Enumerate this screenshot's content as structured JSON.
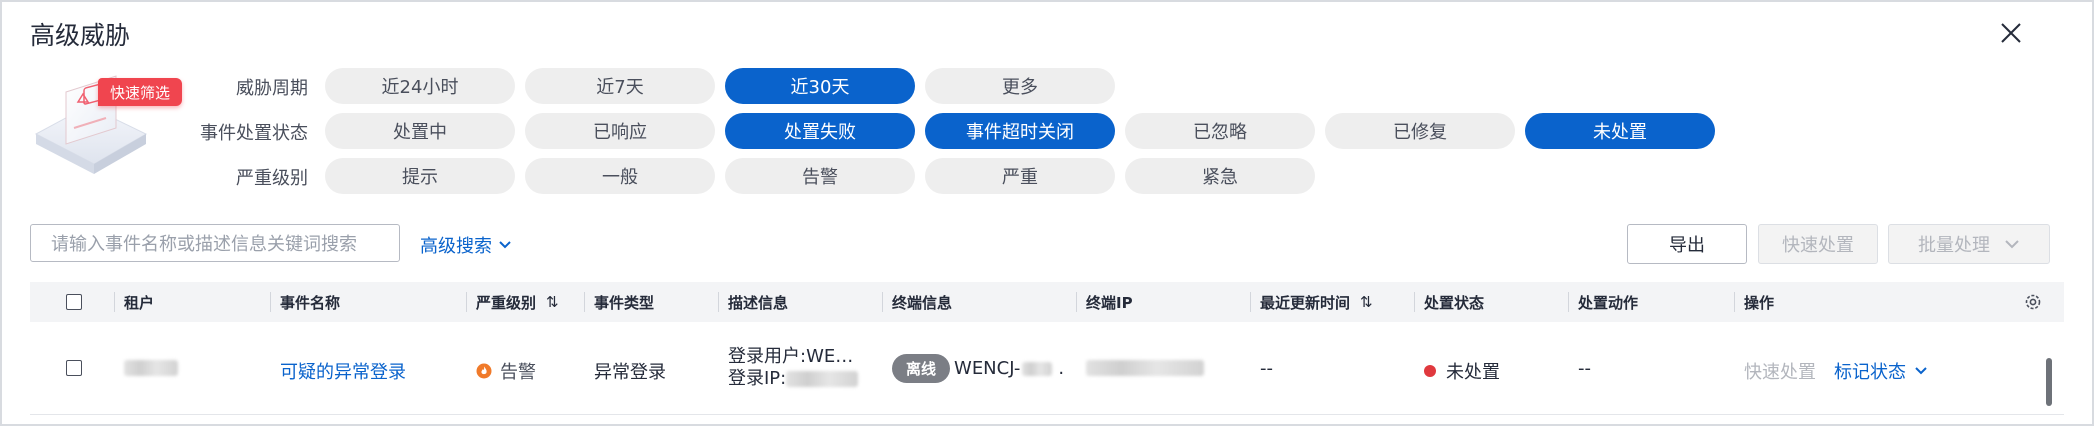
{
  "dialog": {
    "title": "高级威胁"
  },
  "quick_filter": {
    "badge": "快速筛选"
  },
  "filters": {
    "period": {
      "label": "威胁周期",
      "options": [
        "近24小时",
        "近7天",
        "近30天",
        "更多"
      ],
      "selected": [
        "近30天"
      ]
    },
    "status": {
      "label": "事件处置状态",
      "options": [
        "处置中",
        "已响应",
        "处置失败",
        "事件超时关闭",
        "已忽略",
        "已修复",
        "未处置"
      ],
      "selected": [
        "处置失败",
        "事件超时关闭",
        "未处置"
      ]
    },
    "severity": {
      "label": "严重级别",
      "options": [
        "提示",
        "一般",
        "告警",
        "严重",
        "紧急"
      ],
      "selected": []
    }
  },
  "toolbar": {
    "search_placeholder": "请输入事件名称或描述信息关键词搜索",
    "advanced_search": "高级搜索",
    "export": "导出",
    "quick_handle": "快速处置",
    "batch_handle": "批量处理"
  },
  "table": {
    "columns": [
      "租户",
      "事件名称",
      "严重级别",
      "事件类型",
      "描述信息",
      "终端信息",
      "终端IP",
      "最近更新时间",
      "处置状态",
      "处置动作",
      "操作"
    ],
    "rows": [
      {
        "event_name": "可疑的异常登录",
        "severity": "告警",
        "event_type": "异常登录",
        "desc_line1": "登录用户:WE…",
        "desc_line2": "登录IP:",
        "terminal_status": "离线",
        "terminal_name": "WENCJ-",
        "terminal_suffix": ".",
        "update_time": "--",
        "status": "未处置",
        "action": "--",
        "op_quick": "快速处置",
        "op_mark": "标记状态"
      }
    ]
  },
  "colors": {
    "primary": "#0a63cc",
    "chip_bg": "#eeeeee",
    "danger": "#e0393e",
    "warning": "#f07a2a",
    "badge": "#f0454f"
  }
}
